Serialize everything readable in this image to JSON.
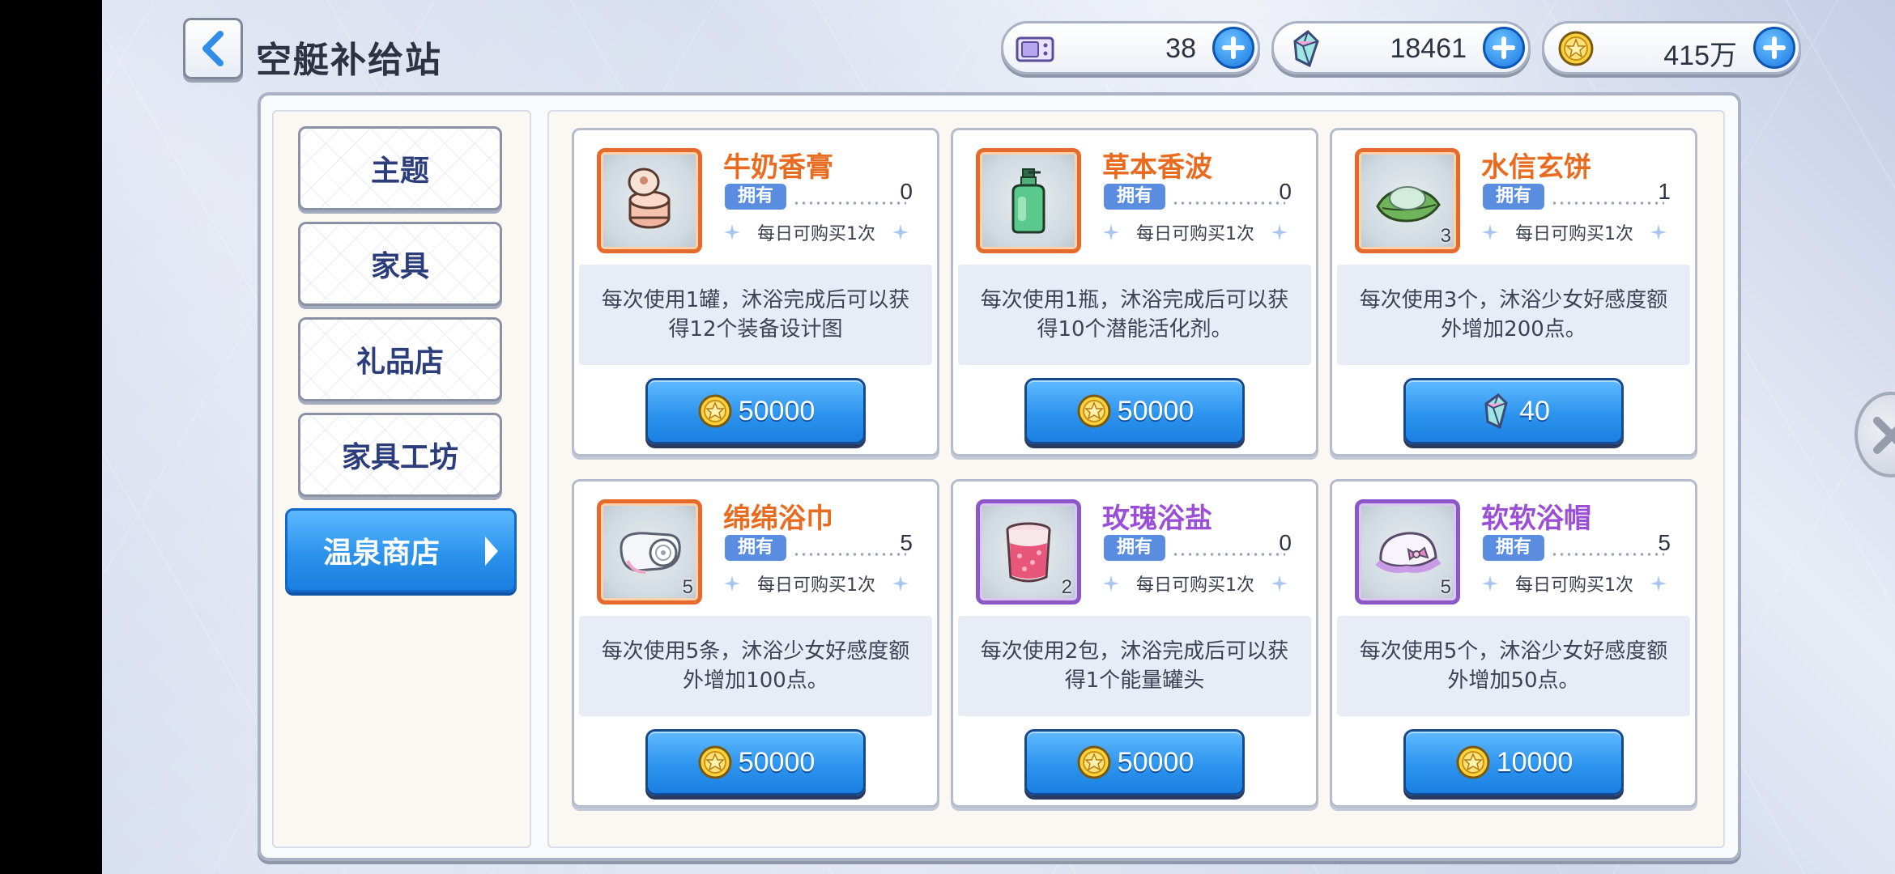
{
  "header": {
    "title": "空艇补给站"
  },
  "currencies": [
    {
      "icon": "ticket-icon",
      "value": "38"
    },
    {
      "icon": "crystal-icon",
      "value": "18461"
    },
    {
      "icon": "star-coin-icon",
      "value": "415万"
    }
  ],
  "sidebar": {
    "items": [
      {
        "label": "主题",
        "active": false
      },
      {
        "label": "家具",
        "active": false
      },
      {
        "label": "礼品店",
        "active": false
      },
      {
        "label": "家具工坊",
        "active": false
      },
      {
        "label": "温泉商店",
        "active": true
      }
    ]
  },
  "shop": {
    "owned_label": "拥有",
    "limit_text": "每日可购买1次",
    "items": [
      {
        "name": "牛奶香膏",
        "rarity": "orange",
        "icon": "milk-cream-jar-icon",
        "qty": "",
        "owned": "0",
        "desc": "每次使用1罐，沐浴完成后可以获得12个装备设计图",
        "currency_icon": "star-coin-icon",
        "price": "50000"
      },
      {
        "name": "草本香波",
        "rarity": "orange",
        "icon": "herbal-shampoo-bottle-icon",
        "qty": "",
        "owned": "0",
        "desc": "每次使用1瓶，沐浴完成后可以获得10个潜能活化剂。",
        "currency_icon": "star-coin-icon",
        "price": "50000"
      },
      {
        "name": "水信玄饼",
        "rarity": "orange",
        "icon": "water-cake-icon",
        "qty": "3",
        "owned": "1",
        "desc": "每次使用3个，沐浴少女好感度额外增加200点。",
        "currency_icon": "crystal-icon",
        "price": "40"
      },
      {
        "name": "绵绵浴巾",
        "rarity": "orange",
        "icon": "rolled-towel-icon",
        "qty": "5",
        "owned": "5",
        "desc": "每次使用5条，沐浴少女好感度额外增加100点。",
        "currency_icon": "star-coin-icon",
        "price": "50000"
      },
      {
        "name": "玫瑰浴盐",
        "rarity": "purple",
        "icon": "rose-bath-salt-jar-icon",
        "qty": "2",
        "owned": "0",
        "desc": "每次使用2包，沐浴完成后可以获得1个能量罐头",
        "currency_icon": "star-coin-icon",
        "price": "50000"
      },
      {
        "name": "软软浴帽",
        "rarity": "purple",
        "icon": "bath-cap-icon",
        "qty": "5",
        "owned": "5",
        "desc": "每次使用5个，沐浴少女好感度额外增加50点。",
        "currency_icon": "star-coin-icon",
        "price": "10000"
      }
    ]
  },
  "colors": {
    "accent_blue": "#2d94ee",
    "orange_rarity": "#e56a2c",
    "purple_rarity": "#8c58c8"
  }
}
